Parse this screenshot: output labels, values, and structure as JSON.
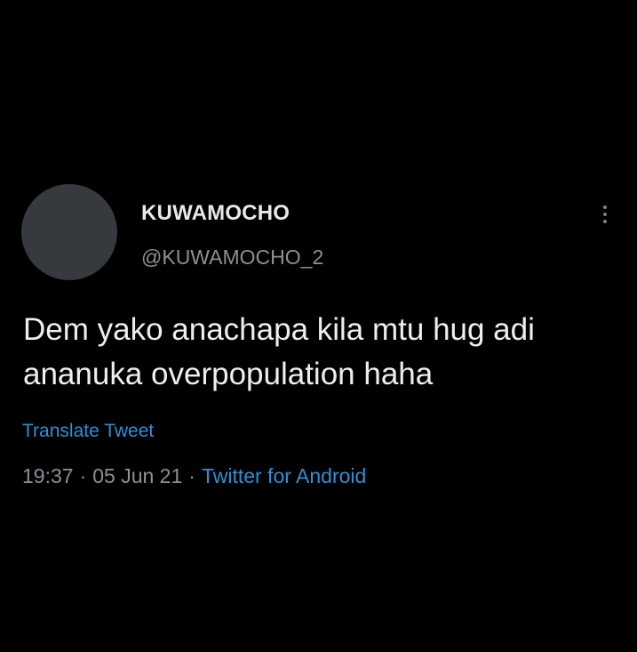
{
  "tweet": {
    "display_name": "KUWAMOCHO",
    "handle": "@KUWAMOCHO_2",
    "text_line_1": "Dem yako anachapa kila mtu hug adi",
    "text_line_2": "ananuka overpopulation haha",
    "translate_label": "Translate Tweet",
    "time": "19:37",
    "separator": "·",
    "date": "05 Jun 21",
    "source": "Twitter for Android",
    "more_icon": "vertical-ellipsis-icon"
  },
  "colors": {
    "background": "#000000",
    "primary_text": "#e7e9ea",
    "secondary_text": "#8b9096",
    "link": "#2f8fd6",
    "avatar_placeholder": "#36393e"
  }
}
